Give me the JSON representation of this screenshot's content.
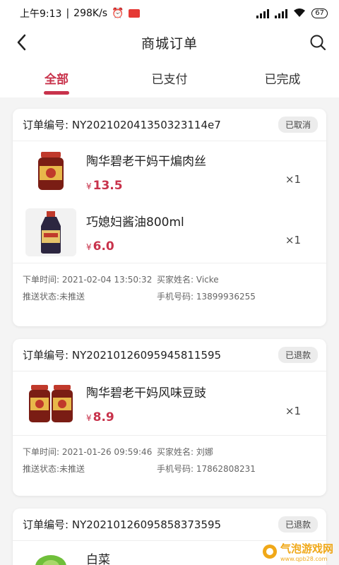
{
  "status_bar": {
    "time": "上午9:13",
    "speed": "298K/s",
    "battery": "67"
  },
  "header": {
    "title": "商城订单"
  },
  "tabs": [
    {
      "label": "全部",
      "active": true
    },
    {
      "label": "已支付",
      "active": false
    },
    {
      "label": "已完成",
      "active": false
    }
  ],
  "orders": [
    {
      "order_label": "订单编号:",
      "order_no": "NY202102041350323114e7",
      "status": "已取消",
      "items": [
        {
          "name": "陶华碧老干妈干煸肉丝",
          "currency": "¥",
          "price": "13.5",
          "qty": "×1",
          "thumb": "jar-icon"
        },
        {
          "name": "巧媳妇酱油800ml",
          "currency": "¥",
          "price": "6.0",
          "qty": "×1",
          "thumb": "soy-bottle-icon"
        }
      ],
      "order_time_label": "下单时间:",
      "order_time": "2021-02-04 13:50:32",
      "buyer_label": "买家姓名:",
      "buyer": "Vicke",
      "push_label": "推送状态:",
      "push_status": "未推送",
      "phone_label": "手机号码:",
      "phone": "13899936255"
    },
    {
      "order_label": "订单编号:",
      "order_no": "NY20210126095945811595",
      "status": "已退款",
      "items": [
        {
          "name": "陶华碧老干妈风味豆豉",
          "currency": "¥",
          "price": "8.9",
          "qty": "×1",
          "thumb": "twin-jar-icon"
        }
      ],
      "order_time_label": "下单时间:",
      "order_time": "2021-01-26 09:59:46",
      "buyer_label": "买家姓名:",
      "buyer": "刘娜",
      "push_label": "推送状态:",
      "push_status": "未推送",
      "phone_label": "手机号码:",
      "phone": "17862808231"
    },
    {
      "order_label": "订单编号:",
      "order_no": "NY20210126095858373595",
      "status": "已退款",
      "items": [
        {
          "name": "白菜",
          "thumb": "cabbage-icon"
        }
      ]
    }
  ],
  "watermark": {
    "text": "气泡游戏网",
    "sub": "www.qpb28.com"
  },
  "colors": {
    "accent": "#c8324b",
    "badge_bg": "#ececec"
  }
}
